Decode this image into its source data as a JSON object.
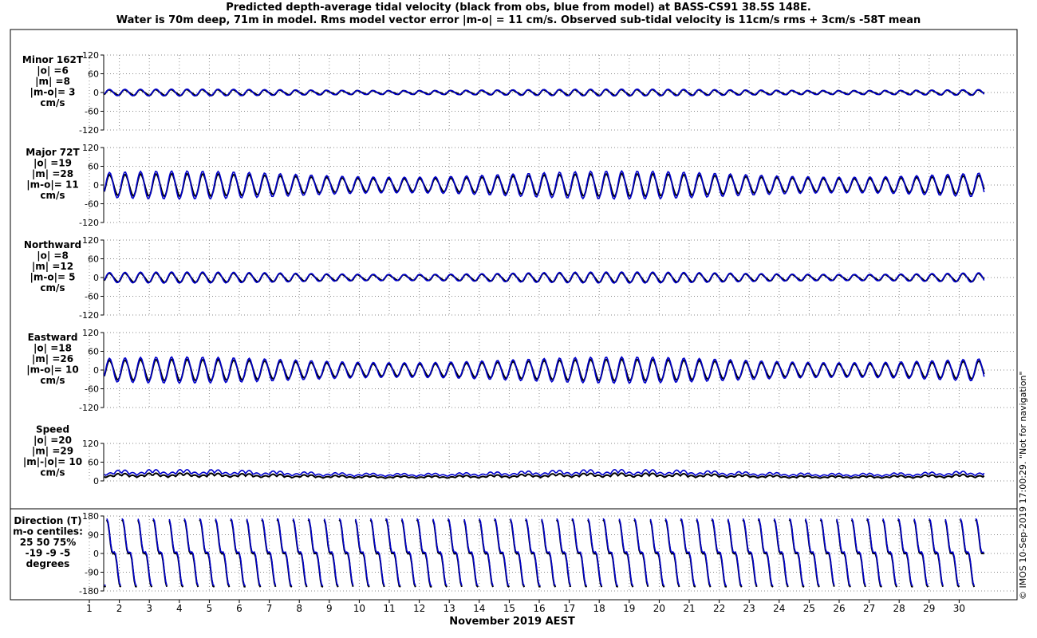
{
  "title_lines": [
    "Predicted depth-average tidal velocity (black from obs, blue from model) at BASS-CS91 38.5S 148E.",
    "Water is 70m deep, 71m in model. Rms model vector error |m-o| = 11 cm/s. Observed sub-tidal velocity is 11cm/s rms + 3cm/s -58T mean"
  ],
  "credit": "© IMOS 10-Sep-2019 17:00:29. \"Not for navigation\"",
  "colors": {
    "obs": "#000000",
    "model": "#0000cc",
    "grid": "#888888",
    "axis": "#000000"
  },
  "chart_data": {
    "type": "line",
    "xlabel": "November 2019 AEST",
    "x_ticks": [
      "1",
      "2",
      "3",
      "4",
      "5",
      "6",
      "7",
      "8",
      "9",
      "10",
      "11",
      "12",
      "13",
      "14",
      "15",
      "16",
      "17",
      "18",
      "19",
      "20",
      "21",
      "22",
      "23",
      "24",
      "25",
      "26",
      "27",
      "28",
      "29",
      "30"
    ],
    "series_names": [
      "black from obs",
      "blue from model"
    ],
    "panels": [
      {
        "id": "minor",
        "label_lines": [
          "Minor 162T",
          "|o| =6",
          "|m| =8",
          "|m-o|= 3",
          "cm/s"
        ],
        "ylim": [
          -120,
          120
        ],
        "y_ticks": [
          "120",
          "60",
          "0",
          "-60",
          "-120"
        ],
        "y_tick_values": [
          120,
          60,
          0,
          -60,
          -120
        ],
        "obs_amplitude": 9,
        "model_amplitude": 11
      },
      {
        "id": "major",
        "label_lines": [
          "Major 72T",
          "|o| =19",
          "|m| =28",
          "|m-o|= 11",
          "cm/s"
        ],
        "ylim": [
          -120,
          120
        ],
        "y_ticks": [
          "120",
          "60",
          "0",
          "-60",
          "-120"
        ],
        "y_tick_values": [
          120,
          60,
          0,
          -60,
          -120
        ],
        "obs_amplitude": 36,
        "model_amplitude": 45
      },
      {
        "id": "northward",
        "label_lines": [
          "Northward",
          "|o| =8",
          "|m| =12",
          "|m-o|= 5",
          "cm/s"
        ],
        "ylim": [
          -120,
          120
        ],
        "y_ticks": [
          "120",
          "60",
          "0",
          "-60",
          "-120"
        ],
        "y_tick_values": [
          120,
          60,
          0,
          -60,
          -120
        ],
        "obs_amplitude": 15,
        "model_amplitude": 18
      },
      {
        "id": "eastward",
        "label_lines": [
          "Eastward",
          "|o| =18",
          "|m| =26",
          "|m-o|= 10",
          "cm/s"
        ],
        "ylim": [
          -120,
          120
        ],
        "y_ticks": [
          "120",
          "60",
          "0",
          "-60",
          "-120"
        ],
        "y_tick_values": [
          120,
          60,
          0,
          -60,
          -120
        ],
        "obs_amplitude": 34,
        "model_amplitude": 42
      },
      {
        "id": "speed",
        "label_lines": [
          "Speed",
          "|o| =20",
          "|m| =29",
          "|m|-|o|= 10",
          "cm/s"
        ],
        "ylim": [
          0,
          120
        ],
        "y_ticks": [
          "120",
          "60",
          "0"
        ],
        "y_tick_values": [
          120,
          60,
          0
        ],
        "obs_amplitude": 22,
        "model_amplitude": 30
      },
      {
        "id": "direction",
        "label_lines": [
          "Direction (T)",
          "m-o centiles:",
          "25  50  75%",
          "-19  -9  -5",
          "degrees"
        ],
        "ylim": [
          -180,
          180
        ],
        "y_ticks": [
          "180",
          "90",
          "0",
          "-90",
          "-180"
        ],
        "y_tick_values": [
          180,
          90,
          0,
          -90,
          -180
        ]
      }
    ]
  }
}
